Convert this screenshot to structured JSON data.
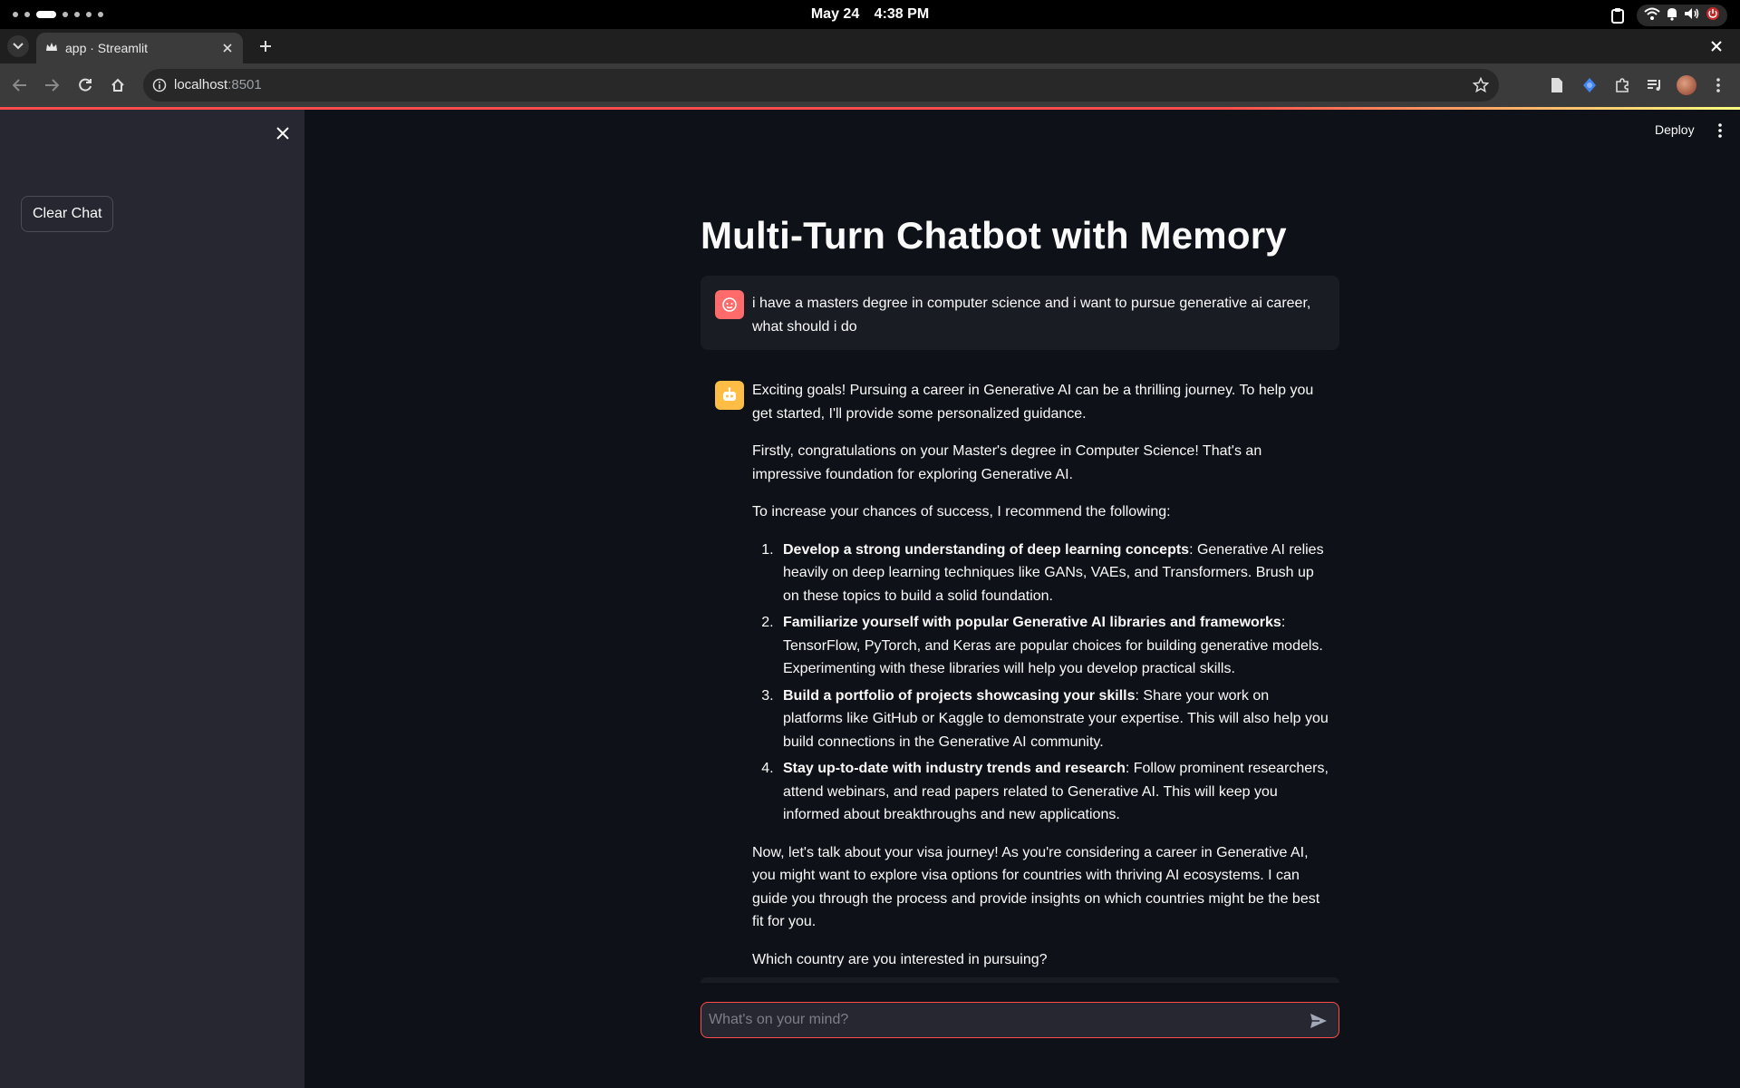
{
  "os": {
    "date": "May 24",
    "time": "4:38 PM"
  },
  "browser": {
    "tab_title": "app · Streamlit",
    "url_host": "localhost",
    "url_port": ":8501"
  },
  "sidebar": {
    "clear_chat_label": "Clear Chat"
  },
  "header": {
    "deploy_label": "Deploy"
  },
  "page": {
    "title": "Multi-Turn Chatbot with Memory"
  },
  "chat": {
    "user_message": "i have a masters degree in computer science and i want to pursue generative ai career, what should i do",
    "assistant": {
      "intro": "Exciting goals! Pursuing a career in Generative AI can be a thrilling journey. To help you get started, I'll provide some personalized guidance.",
      "p2": "Firstly, congratulations on your Master's degree in Computer Science! That's an impressive foundation for exploring Generative AI.",
      "p3": "To increase your chances of success, I recommend the following:",
      "list": [
        {
          "bold": "Develop a strong understanding of deep learning concepts",
          "text": ": Generative AI relies heavily on deep learning techniques like GANs, VAEs, and Transformers. Brush up on these topics to build a solid foundation."
        },
        {
          "bold": "Familiarize yourself with popular Generative AI libraries and frameworks",
          "text": ": TensorFlow, PyTorch, and Keras are popular choices for building generative models. Experimenting with these libraries will help you develop practical skills."
        },
        {
          "bold": "Build a portfolio of projects showcasing your skills",
          "text": ": Share your work on platforms like GitHub or Kaggle to demonstrate your expertise. This will also help you build connections in the Generative AI community."
        },
        {
          "bold": "Stay up-to-date with industry trends and research",
          "text": ": Follow prominent researchers, attend webinars, and read papers related to Generative AI. This will keep you informed about breakthroughs and new applications."
        }
      ],
      "p4": "Now, let's talk about your visa journey! As you're considering a career in Generative AI, you might want to explore visa options for countries with thriving AI ecosystems. I can guide you through the process and provide insights on which countries might be the best fit for you.",
      "p5": "Which country are you interested in pursuing?"
    },
    "input_placeholder": "What's on your mind?"
  },
  "colors": {
    "accent": "#ff4b4b",
    "user_avatar": "#ff6b6b",
    "bot_avatar": "#ffbd45",
    "bg": "#0e1117",
    "sidebar_bg": "#262730"
  }
}
